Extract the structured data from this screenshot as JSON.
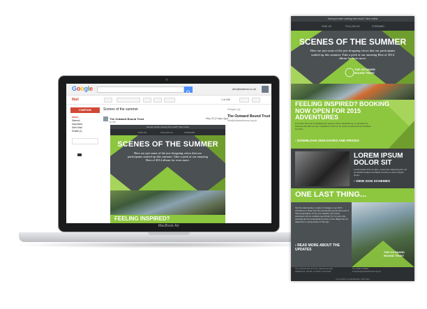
{
  "device": {
    "label": "MacBook Air"
  },
  "gmail": {
    "logo": "Google",
    "mail_label": "Mail",
    "account_email": "abc@andrew.co.uk",
    "compose_label": "COMPOSE",
    "nav": [
      "Inbox",
      "Starred",
      "Important",
      "Sent Mail",
      "Drafts (1)"
    ],
    "subject": "Scenes of the summer",
    "sender_name": "The Outward Bound Trust",
    "sender_to": "to me",
    "date": "May 23 (2 days ago)",
    "people_label": "People (1)",
    "people_name": "The Outward Bound Trust",
    "people_email": "info@outwardbound.org.uk",
    "count": "1 of 180"
  },
  "email": {
    "preheader": "Having trouble viewing this email? View online",
    "social": [
      "FIND US",
      "FOLLOW US",
      "FORWARD"
    ],
    "hero_title": "SCENES OF THE SUMMER",
    "hero_text": "Here are just some of the jaw-dropping views that our participants soaked up this summer. Take a peek at our amazing Best of 2014 album for even more.",
    "brand": "THE OUTWARD BOUND TRUST",
    "feeling_title": "FEELING INSPIRED? BOOKING NOW OPEN FOR 2015 ADVENTURES",
    "feeling_short": "FEELING INSPIRED?",
    "feeling_body": "If you like the look of sampling the outdoors from a mountain top or anywhere in-between, the dates are now available for 2015 so do reach out and book an adventure for 2015.",
    "download_cta": "DOWNLOAD 2015 DATES AND PRICES",
    "lorem_title": "LOREM IPSUM DOLOR SIT",
    "lorem_body": "Lorem ipsum dolor sit amet, consectetur adipiscing elit, sed do eiusmod tempor incididunt ut labore et dolore magna aliqua.",
    "view_cta": "VIEW 2015 SCHEMES",
    "last_title": "ONE LAST THING...",
    "last_body": "We'll be introducing a couple of changes to our 2015 adventures to make sure that participants get the most out of their programmes. Every new summer, the Classic Adventure will be available specifically for 14 year olds, ensuring that the programme focusses on the things that are important to young people of that age.",
    "read_cta": "READ MORE ABOUT THE UPDATES",
    "footer_address": "The Outward Bound Trust, Hackthorpe Hall, Hackthorpe, Penrith, Cumbria, CA10 2HX",
    "footer_contact": "Tel: 01931 740000  enquiries@outwardbound.org.uk",
    "unsubscribe": "If you wish to unsubscribe, click here"
  }
}
